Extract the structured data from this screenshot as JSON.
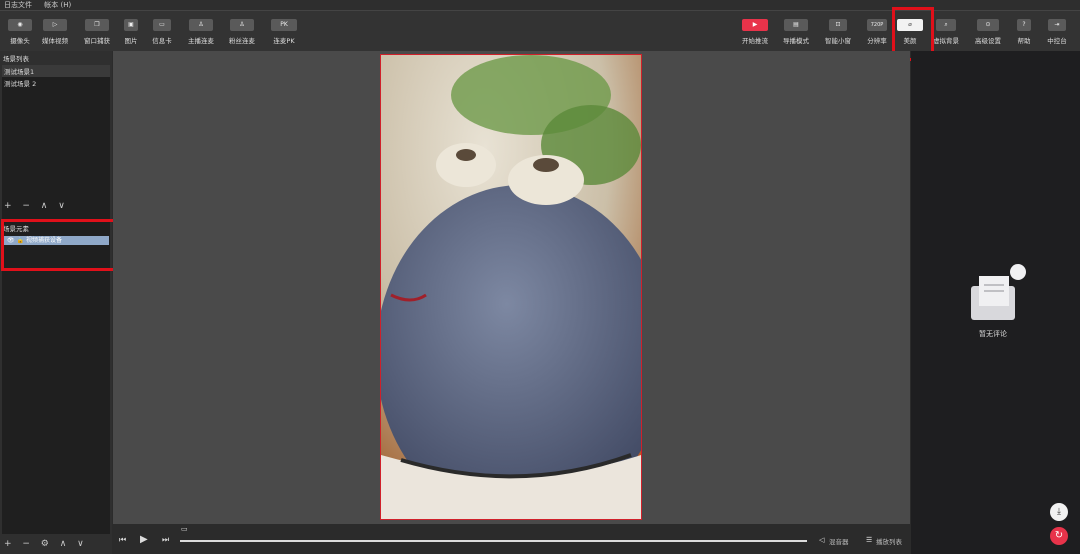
{
  "menu": [
    "日志文件",
    "帐本 (H)"
  ],
  "toolbar_left": [
    {
      "label": "摄像头",
      "icon": "camera-icon",
      "glyph": "◉"
    },
    {
      "label": "媒体视频",
      "icon": "play-icon",
      "glyph": "▷"
    },
    {
      "label": "窗口捕获",
      "icon": "window-icon",
      "glyph": "❐"
    },
    {
      "label": "图片",
      "icon": "image-icon",
      "glyph": "▣"
    },
    {
      "label": "信息卡",
      "icon": "card-icon",
      "glyph": "▭"
    },
    {
      "label": "主播连麦",
      "icon": "user-link-icon",
      "glyph": "♙"
    },
    {
      "label": "粉丝连麦",
      "icon": "fans-link-icon",
      "glyph": "♙"
    },
    {
      "label": "连麦PK",
      "icon": "pk-icon",
      "glyph": "PK"
    }
  ],
  "toolbar_right": [
    {
      "label": "开始推流",
      "icon": "stream-play-icon",
      "glyph": "▶",
      "style": "red"
    },
    {
      "label": "导播模式",
      "icon": "director-icon",
      "glyph": "▤"
    },
    {
      "label": "智能小窗",
      "icon": "smart-window-icon",
      "glyph": "⊡"
    },
    {
      "label": "分辨率",
      "icon": "resolution-icon",
      "glyph": "720P"
    },
    {
      "label": "美颜",
      "icon": "beauty-icon",
      "glyph": "⌀",
      "style": "white"
    },
    {
      "label": "虚拟背景",
      "icon": "virtual-bg-icon",
      "glyph": "⌕"
    },
    {
      "label": "高级设置",
      "icon": "advanced-settings-icon",
      "glyph": "⊙"
    },
    {
      "label": "帮助",
      "icon": "help-icon",
      "glyph": "?"
    },
    {
      "label": "中控台",
      "icon": "console-icon",
      "glyph": "⇥"
    }
  ],
  "scenes": {
    "title": "场景列表",
    "items": [
      "测试场景1",
      "测试场景 2"
    ],
    "controls": "+ − ∧ ∨"
  },
  "elements": {
    "title": "场景元素",
    "items": [
      "视频捕获设备"
    ],
    "controls": "+ − ⚙ ∧ ∨"
  },
  "playback": {
    "mixer": "混音器",
    "playlist": "播放列表"
  },
  "comments": {
    "empty": "暂无评论"
  }
}
